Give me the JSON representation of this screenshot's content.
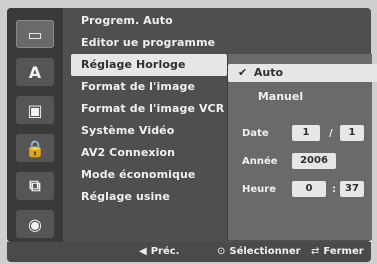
{
  "left_icons": [
    {
      "icon": "film-icon",
      "glyph": "▭"
    },
    {
      "icon": "language-icon",
      "glyph": "A"
    },
    {
      "icon": "speaker-icon",
      "glyph": "▣"
    },
    {
      "icon": "lock-icon",
      "glyph": "🔒"
    },
    {
      "icon": "record-icon",
      "glyph": "⧉"
    },
    {
      "icon": "disc-icon",
      "glyph": "◉"
    }
  ],
  "menu": {
    "items": [
      "Progrem. Auto",
      "Editor ue programme",
      "Réglage Horloge",
      "Format de l'image",
      "Format de l'image VCR",
      "Système Vidéo",
      "AV2 Connexion",
      "Mode économique",
      "Réglage usine"
    ],
    "selected_index": 2
  },
  "right_panel": {
    "options": [
      {
        "label": "Auto",
        "selected": true,
        "check": "✔"
      },
      {
        "label": "Manuel",
        "selected": false,
        "check": ""
      }
    ],
    "date": {
      "label": "Date",
      "day": "1",
      "sep": "/",
      "month": "1"
    },
    "year": {
      "label": "Année",
      "value": "2006"
    },
    "time": {
      "label": "Heure",
      "hour": "0",
      "sep": ":",
      "minute": "37"
    }
  },
  "footer": {
    "prev": {
      "sym": "◀",
      "label": "Préc."
    },
    "select": {
      "sym": "⊙",
      "label": "Sélectionner"
    },
    "close": {
      "sym": "⇄",
      "label": "Fermer"
    }
  }
}
